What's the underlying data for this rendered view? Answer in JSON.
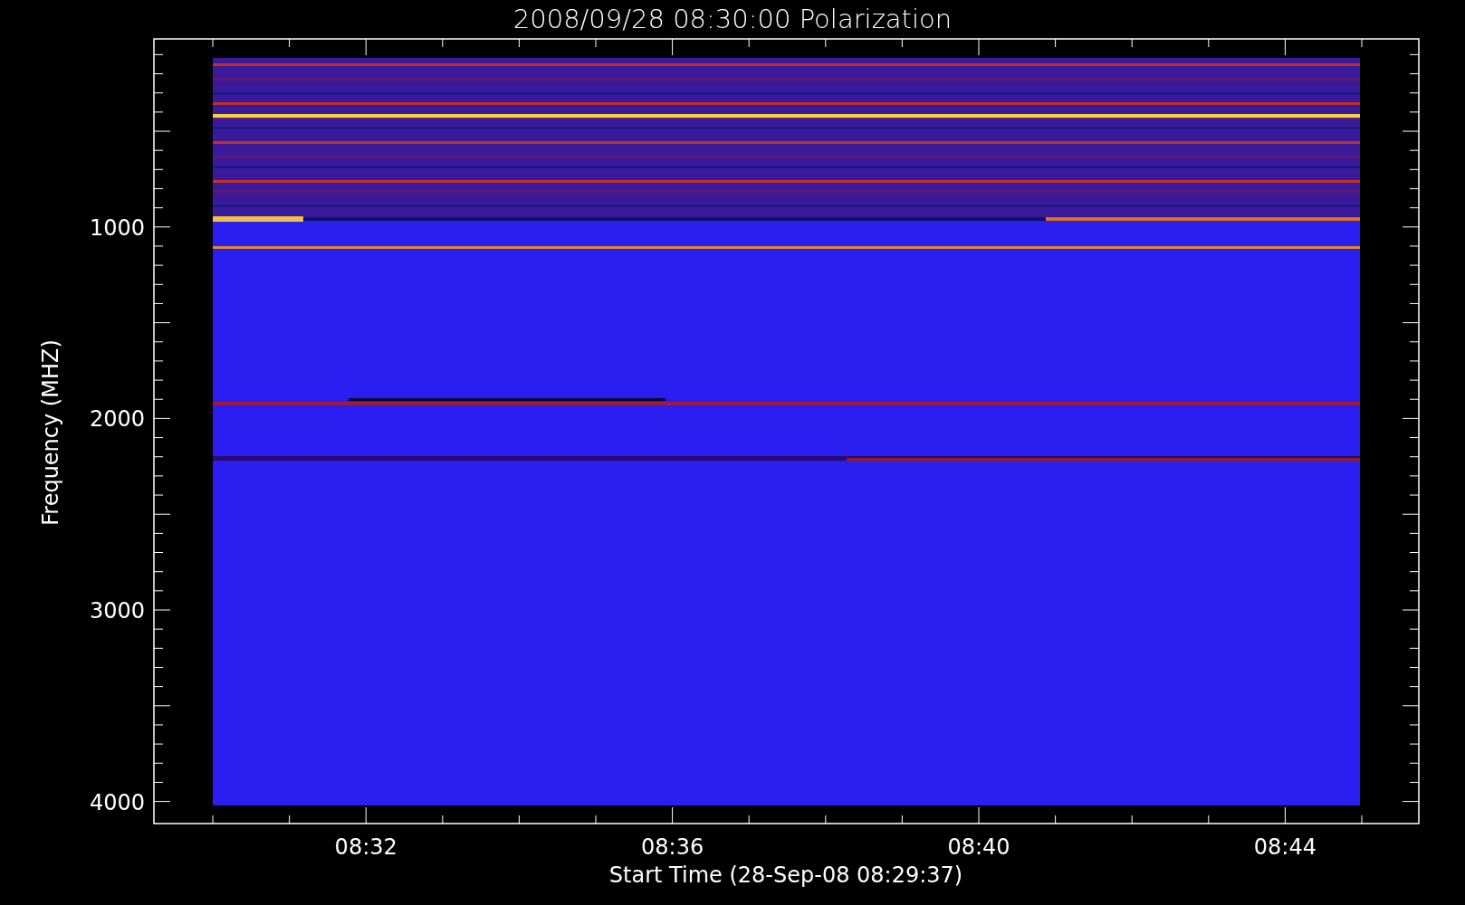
{
  "title": "2008/09/28 08:30:00 Polarization",
  "plot": {
    "xlabel": "Start Time (28-Sep-08 08:29:37)",
    "ylabel": "Frequency (MHZ)",
    "xtick_labels": [
      "08:32",
      "08:36",
      "08:40",
      "08:44"
    ],
    "ytick_labels": [
      "1000",
      "2000",
      "3000",
      "4000"
    ]
  }
}
